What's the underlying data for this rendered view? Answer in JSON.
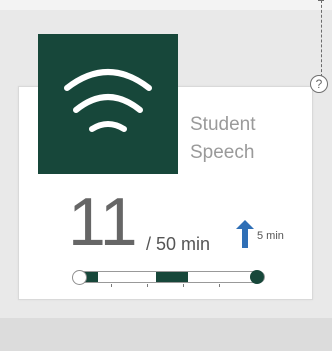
{
  "card": {
    "title_line1": "Student",
    "title_line2": "Speech",
    "value": "11",
    "denominator": "/ 50 min",
    "delta": "5 min",
    "help": "?",
    "timeline_segments": [
      {
        "start": 0.05,
        "end": 0.12
      },
      {
        "start": 0.43,
        "end": 0.6
      }
    ],
    "timeline_ticks": [
      0.19,
      0.38,
      0.57,
      0.76
    ]
  },
  "icons": {
    "main": "wifi-icon",
    "trend": "arrow-up-icon",
    "help": "help-icon"
  },
  "colors": {
    "accent": "#17473a",
    "trend": "#2f6fb6",
    "text_muted": "#9a9a9a",
    "value_text": "#666666"
  }
}
